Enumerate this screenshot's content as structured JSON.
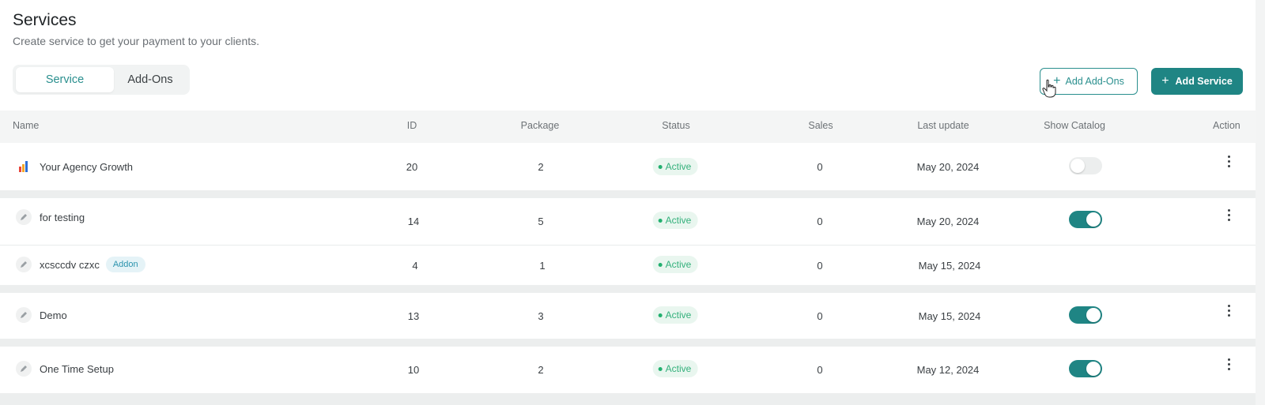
{
  "page": {
    "title": "Services",
    "subtitle": "Create service to get your payment to your clients."
  },
  "tabs": [
    {
      "label": "Service",
      "active": true
    },
    {
      "label": "Add-Ons",
      "active": false
    }
  ],
  "actions": {
    "add_addons_label": "Add Add-Ons",
    "add_service_label": "Add Service"
  },
  "table": {
    "columns": [
      "Name",
      "ID",
      "Package",
      "Status",
      "Sales",
      "Last update",
      "Show Catalog",
      "Action"
    ],
    "rows": [
      {
        "name": "Your Agency Growth",
        "icon": "chart-logo-icon",
        "id": "20",
        "package": "2",
        "status": "Active",
        "sales": "0",
        "last_update": "May 20, 2024",
        "show_catalog": false,
        "has_toggle": true,
        "has_action": true
      },
      {
        "name": "for testing",
        "icon": "pencil-icon",
        "id": "14",
        "package": "5",
        "status": "Active",
        "sales": "0",
        "last_update": "May 20, 2024",
        "show_catalog": true,
        "has_toggle": true,
        "has_action": true
      },
      {
        "name": "xcsccdv czxc",
        "icon": "pencil-icon",
        "badge": "Addon",
        "id": "4",
        "package": "1",
        "status": "Active",
        "sales": "0",
        "last_update": "May 15, 2024",
        "has_toggle": false,
        "has_action": false
      },
      {
        "name": "Demo",
        "icon": "pencil-icon",
        "id": "13",
        "package": "3",
        "status": "Active",
        "sales": "0",
        "last_update": "May 15, 2024",
        "show_catalog": true,
        "has_toggle": true,
        "has_action": true
      },
      {
        "name": "One Time Setup",
        "icon": "pencil-icon",
        "id": "10",
        "package": "2",
        "status": "Active",
        "sales": "0",
        "last_update": "May 12, 2024",
        "show_catalog": true,
        "has_toggle": true,
        "has_action": true
      }
    ]
  },
  "colors": {
    "accent": "#1f8584",
    "status_active": "#22b06f",
    "addon_badge": "#2b93ad"
  }
}
